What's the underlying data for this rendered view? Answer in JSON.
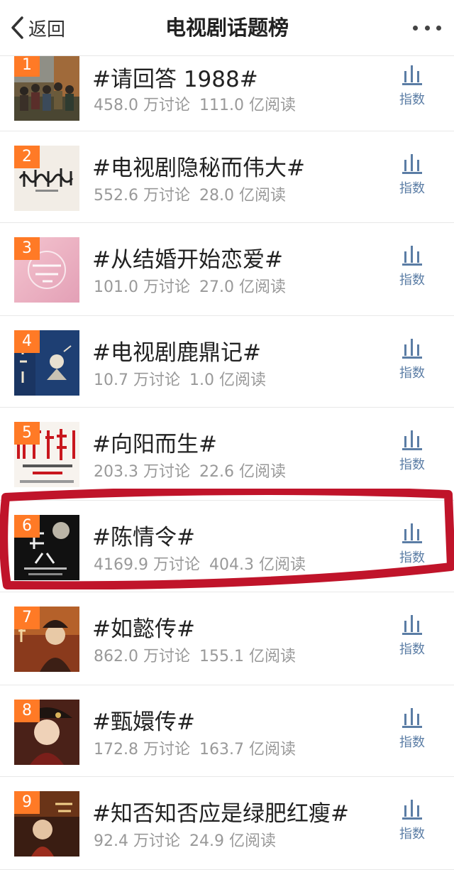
{
  "nav": {
    "back_label": "返回",
    "title": "电视剧话题榜",
    "more_icon": "more-dots-icon"
  },
  "colors": {
    "rank_badge": "#ff7a26",
    "index_blue": "#5b7da5",
    "highlight_red": "#c0142a"
  },
  "items": [
    {
      "rank": "1",
      "topic": "#请回答 1988#",
      "discussions": "458.0 万讨论",
      "reads": "111.0 亿阅读",
      "index_label": "指数"
    },
    {
      "rank": "2",
      "topic": "#电视剧隐秘而伟大#",
      "discussions": "552.6 万讨论",
      "reads": "28.0 亿阅读",
      "index_label": "指数"
    },
    {
      "rank": "3",
      "topic": "#从结婚开始恋爱#",
      "discussions": "101.0 万讨论",
      "reads": "27.0 亿阅读",
      "index_label": "指数"
    },
    {
      "rank": "4",
      "topic": "#电视剧鹿鼎记#",
      "discussions": "10.7 万讨论",
      "reads": "1.0 亿阅读",
      "index_label": "指数"
    },
    {
      "rank": "5",
      "topic": "#向阳而生#",
      "discussions": "203.3 万讨论",
      "reads": "22.6 亿阅读",
      "index_label": "指数"
    },
    {
      "rank": "6",
      "topic": "#陈情令#",
      "discussions": "4169.9 万讨论",
      "reads": "404.3 亿阅读",
      "index_label": "指数"
    },
    {
      "rank": "7",
      "topic": "#如懿传#",
      "discussions": "862.0 万讨论",
      "reads": "155.1 亿阅读",
      "index_label": "指数"
    },
    {
      "rank": "8",
      "topic": "#甄嬛传#",
      "discussions": "172.8 万讨论",
      "reads": "163.7 亿阅读",
      "index_label": "指数"
    },
    {
      "rank": "9",
      "topic": "#知否知否应是绿肥红瘦#",
      "discussions": "92.4 万讨论",
      "reads": "24.9 亿阅读",
      "index_label": "指数"
    }
  ]
}
